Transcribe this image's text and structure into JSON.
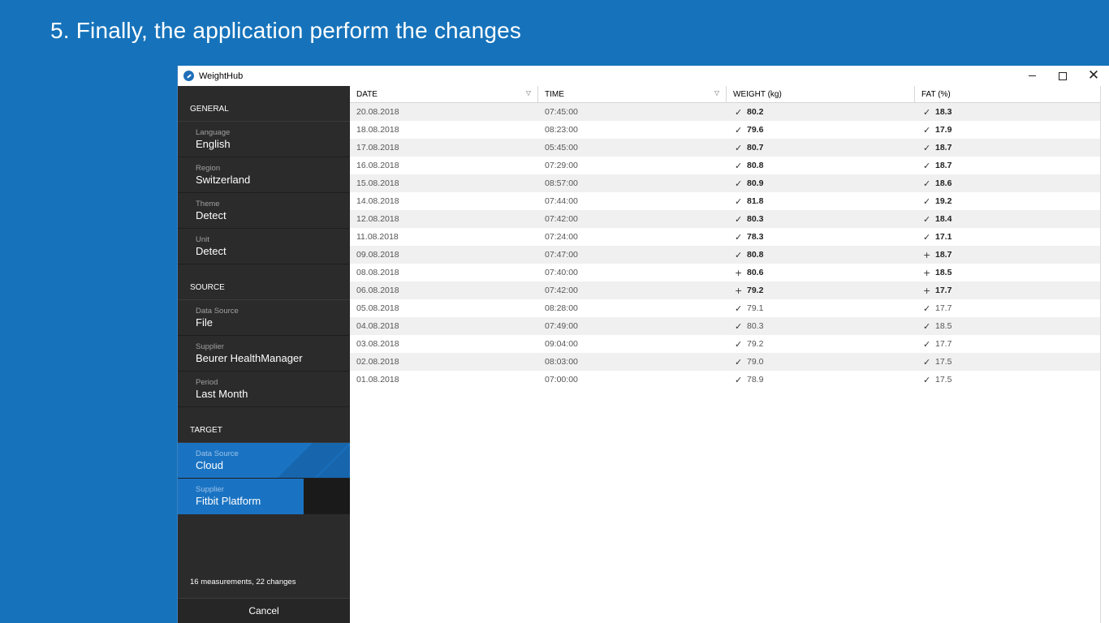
{
  "slide_title": "5. Finally, the application perform the changes",
  "window": {
    "title": "WeightHub"
  },
  "sidebar": {
    "general_header": "GENERAL",
    "general": [
      {
        "label": "Language",
        "value": "English"
      },
      {
        "label": "Region",
        "value": "Switzerland"
      },
      {
        "label": "Theme",
        "value": "Detect"
      },
      {
        "label": "Unit",
        "value": "Detect"
      }
    ],
    "source_header": "SOURCE",
    "source": [
      {
        "label": "Data Source",
        "value": "File"
      },
      {
        "label": "Supplier",
        "value": "Beurer HealthManager"
      },
      {
        "label": "Period",
        "value": "Last Month"
      }
    ],
    "target_header": "TARGET",
    "target": [
      {
        "label": "Data Source",
        "value": "Cloud"
      },
      {
        "label": "Supplier",
        "value": "Fitbit Platform"
      }
    ],
    "summary": "16 measurements, 22 changes",
    "cancel_label": "Cancel"
  },
  "table": {
    "columns": [
      "DATE",
      "TIME",
      "WEIGHT (kg)",
      "FAT (%)"
    ],
    "rows": [
      {
        "date": "20.08.2018",
        "time": "07:45:00",
        "weight": "80.2",
        "weight_mark": "✓",
        "weight_changed": true,
        "fat": "18.3",
        "fat_mark": "✓",
        "fat_changed": true
      },
      {
        "date": "18.08.2018",
        "time": "08:23:00",
        "weight": "79.6",
        "weight_mark": "✓",
        "weight_changed": true,
        "fat": "17.9",
        "fat_mark": "✓",
        "fat_changed": true
      },
      {
        "date": "17.08.2018",
        "time": "05:45:00",
        "weight": "80.7",
        "weight_mark": "✓",
        "weight_changed": true,
        "fat": "18.7",
        "fat_mark": "✓",
        "fat_changed": true
      },
      {
        "date": "16.08.2018",
        "time": "07:29:00",
        "weight": "80.8",
        "weight_mark": "✓",
        "weight_changed": true,
        "fat": "18.7",
        "fat_mark": "✓",
        "fat_changed": true
      },
      {
        "date": "15.08.2018",
        "time": "08:57:00",
        "weight": "80.9",
        "weight_mark": "✓",
        "weight_changed": true,
        "fat": "18.6",
        "fat_mark": "✓",
        "fat_changed": true
      },
      {
        "date": "14.08.2018",
        "time": "07:44:00",
        "weight": "81.8",
        "weight_mark": "✓",
        "weight_changed": true,
        "fat": "19.2",
        "fat_mark": "✓",
        "fat_changed": true
      },
      {
        "date": "12.08.2018",
        "time": "07:42:00",
        "weight": "80.3",
        "weight_mark": "✓",
        "weight_changed": true,
        "fat": "18.4",
        "fat_mark": "✓",
        "fat_changed": true
      },
      {
        "date": "11.08.2018",
        "time": "07:24:00",
        "weight": "78.3",
        "weight_mark": "✓",
        "weight_changed": true,
        "fat": "17.1",
        "fat_mark": "✓",
        "fat_changed": true
      },
      {
        "date": "09.08.2018",
        "time": "07:47:00",
        "weight": "80.8",
        "weight_mark": "✓",
        "weight_changed": true,
        "fat": "18.7",
        "fat_mark": "+",
        "fat_changed": true
      },
      {
        "date": "08.08.2018",
        "time": "07:40:00",
        "weight": "80.6",
        "weight_mark": "+",
        "weight_changed": true,
        "fat": "18.5",
        "fat_mark": "+",
        "fat_changed": true
      },
      {
        "date": "06.08.2018",
        "time": "07:42:00",
        "weight": "79.2",
        "weight_mark": "+",
        "weight_changed": true,
        "fat": "17.7",
        "fat_mark": "+",
        "fat_changed": true
      },
      {
        "date": "05.08.2018",
        "time": "08:28:00",
        "weight": "79.1",
        "weight_mark": "✓",
        "weight_changed": false,
        "fat": "17.7",
        "fat_mark": "✓",
        "fat_changed": false
      },
      {
        "date": "04.08.2018",
        "time": "07:49:00",
        "weight": "80.3",
        "weight_mark": "✓",
        "weight_changed": false,
        "fat": "18.5",
        "fat_mark": "✓",
        "fat_changed": false
      },
      {
        "date": "03.08.2018",
        "time": "09:04:00",
        "weight": "79.2",
        "weight_mark": "✓",
        "weight_changed": false,
        "fat": "17.7",
        "fat_mark": "✓",
        "fat_changed": false
      },
      {
        "date": "02.08.2018",
        "time": "08:03:00",
        "weight": "79.0",
        "weight_mark": "✓",
        "weight_changed": false,
        "fat": "17.5",
        "fat_mark": "✓",
        "fat_changed": false
      },
      {
        "date": "01.08.2018",
        "time": "07:00:00",
        "weight": "78.9",
        "weight_mark": "✓",
        "weight_changed": false,
        "fat": "17.5",
        "fat_mark": "✓",
        "fat_changed": false
      }
    ]
  },
  "colors": {
    "background": "#1673bb",
    "sidebar": "#2b2b2b",
    "accent": "#1a73c2",
    "row_alt": "#f0f0f0"
  }
}
